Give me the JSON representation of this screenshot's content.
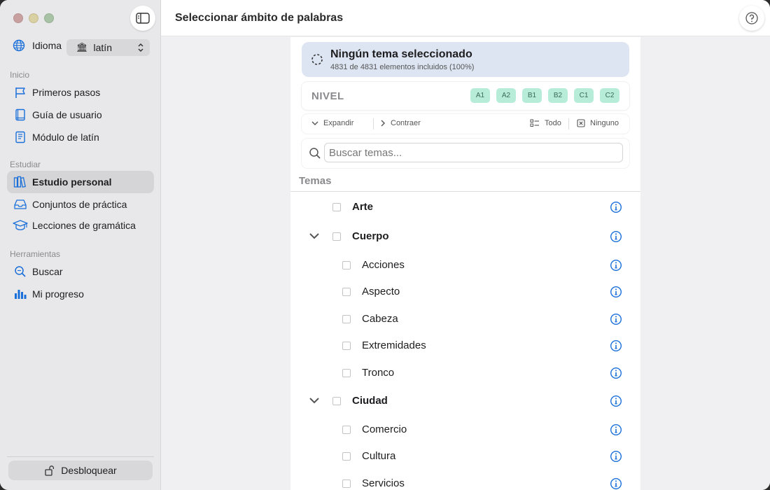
{
  "window": {
    "title": "Seleccionar ámbito de palabras"
  },
  "sidebar": {
    "language_label": "Idioma",
    "language_value": "latín",
    "sections": [
      {
        "label": "Inicio",
        "items": [
          {
            "label": "Primeros pasos",
            "icon": "flag-icon"
          },
          {
            "label": "Guía de usuario",
            "icon": "book-icon"
          },
          {
            "label": "Módulo de latín",
            "icon": "module-book-icon"
          }
        ]
      },
      {
        "label": "Estudiar",
        "items": [
          {
            "label": "Estudio personal",
            "icon": "library-icon",
            "active": true
          },
          {
            "label": "Conjuntos de práctica",
            "icon": "tray-icon"
          },
          {
            "label": "Lecciones de gramática",
            "icon": "graduation-cap-icon"
          }
        ]
      },
      {
        "label": "Herramientas",
        "items": [
          {
            "label": "Buscar",
            "icon": "search-icon"
          },
          {
            "label": "Mi progreso",
            "icon": "bar-chart-icon"
          }
        ]
      }
    ],
    "unlock_label": "Desbloquear"
  },
  "status": {
    "title": "Ningún tema seleccionado",
    "subtitle": "4831 de 4831 elementos incluidos (100%)"
  },
  "level": {
    "label": "NIVEL",
    "badges": [
      "A1",
      "A2",
      "B1",
      "B2",
      "C1",
      "C2"
    ]
  },
  "controls": {
    "expand": "Expandir",
    "collapse": "Contraer",
    "all": "Todo",
    "none": "Ninguno"
  },
  "search": {
    "placeholder": "Buscar temas..."
  },
  "topics": {
    "header": "Temas",
    "rows": [
      {
        "label": "Arte",
        "level": 0,
        "expandable": false
      },
      {
        "label": "Cuerpo",
        "level": 0,
        "expandable": true
      },
      {
        "label": "Acciones",
        "level": 1
      },
      {
        "label": "Aspecto",
        "level": 1
      },
      {
        "label": "Cabeza",
        "level": 1
      },
      {
        "label": "Extremidades",
        "level": 1
      },
      {
        "label": "Tronco",
        "level": 1
      },
      {
        "label": "Ciudad",
        "level": 0,
        "expandable": true
      },
      {
        "label": "Comercio",
        "level": 1
      },
      {
        "label": "Cultura",
        "level": 1
      },
      {
        "label": "Servicios",
        "level": 1
      }
    ]
  },
  "colors": {
    "accent": "#1a6fd9",
    "badge_bg": "#b7ecd9",
    "status_bg": "#dde5f2",
    "sidebar_bg": "#e8e8ea"
  }
}
